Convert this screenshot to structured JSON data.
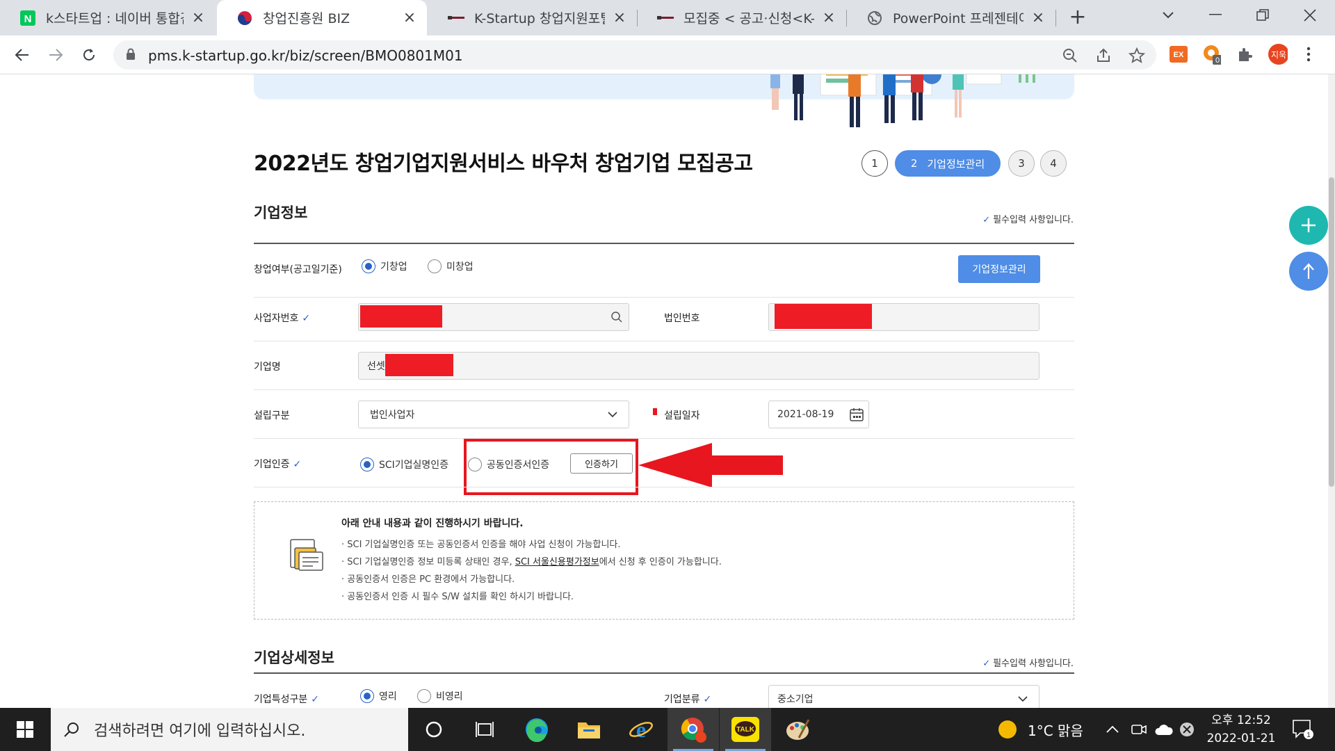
{
  "browser": {
    "tabs": [
      {
        "title": "k스타트업 : 네이버 통합검",
        "favicon": "naver-icon",
        "active": false
      },
      {
        "title": "창업진흥원 BIZ",
        "favicon": "kised-icon",
        "active": true
      },
      {
        "title": "K-Startup 창업지원포털",
        "favicon": "kstartup-icon",
        "active": false
      },
      {
        "title": "모집중 < 공고·신청<K-St",
        "favicon": "kstartup-icon",
        "active": false
      },
      {
        "title": "PowerPoint 프레젠테이션",
        "favicon": "globe-icon",
        "active": false
      }
    ],
    "url": "pms.k-startup.go.kr/biz/screen/BMO0801M01",
    "profile_label": "지욱",
    "ext_badge": "0",
    "ex_label": "EX"
  },
  "page": {
    "title": "2022년도 창업기업지원서비스 바우처 창업기업 모집공고",
    "steps": [
      {
        "num": "1"
      },
      {
        "num": "2",
        "label": "기업정보관리"
      },
      {
        "num": "3"
      },
      {
        "num": "4"
      }
    ],
    "company_section": {
      "title": "기업정보",
      "required_note": "필수입력 사항입니다.",
      "founding_label": "창업여부(공고일기준)",
      "founding_options": [
        "기창업",
        "미창업"
      ],
      "manage_button": "기업정보관리",
      "biz_no_label": "사업자번호",
      "corp_no_label": "법인번호",
      "company_name_label": "기업명",
      "company_name_value": "선셋",
      "est_type_label": "설립구분",
      "est_type_value": "법인사업자",
      "est_date_label": "설립일자",
      "est_date_value": "2021-08-19",
      "cert_label": "기업인증",
      "cert_options": [
        "SCI기업실명인증",
        "공동인증서인증"
      ],
      "cert_button": "인증하기"
    },
    "guide": {
      "title": "아래 안내 내용과 같이 진행하시기 바랍니다.",
      "line1": "· SCI 기업실명인증 또는 공동인증서 인증을 해야 사업 신청이 가능합니다.",
      "line2_pre": "· SCI 기업실명인증 정보 미등록 상태인 경우, ",
      "line2_link": "SCI 서울신용평가정보",
      "line2_post": "에서 신청 후 인증이 가능합니다.",
      "line3": "· 공동인증서 인증은 PC 환경에서 가능합니다.",
      "line4": "· 공동인증서 인증 시 필수 S/W 설치를 확인 하시기 바랍니다."
    },
    "detail_section": {
      "title": "기업상세정보",
      "required_note": "필수입력 사항입니다.",
      "type_label": "기업특성구분",
      "type_options": [
        "영리",
        "비영리"
      ],
      "class_label": "기업분류",
      "class_value": "중소기업"
    }
  },
  "taskbar": {
    "search_placeholder": "검색하려면 여기에 입력하십시오.",
    "weather": "1°C  맑음",
    "time": "오후 12:52",
    "date": "2022-01-21",
    "notif_count": "1"
  },
  "colors": {
    "accent": "#4f8de6",
    "highlight": "#e8161e",
    "fab_plus": "#1fb8b0",
    "fab_up": "#4f8de6"
  }
}
